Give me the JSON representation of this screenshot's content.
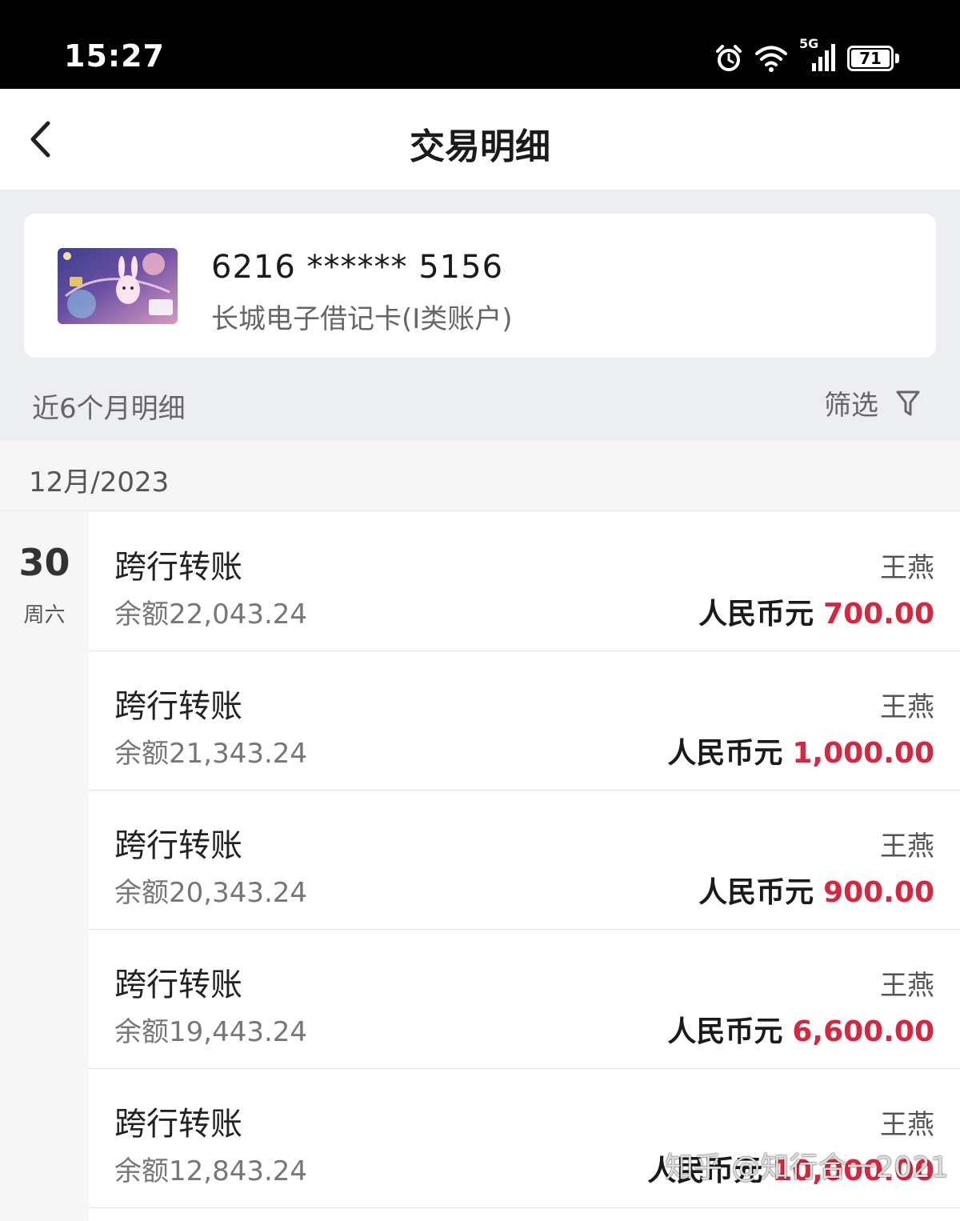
{
  "status_bar": {
    "time": "15:27",
    "network_type": "5G",
    "battery_level": "71",
    "icons": [
      "alarm-icon",
      "wifi-icon",
      "signal-icon",
      "battery-icon"
    ]
  },
  "header": {
    "title": "交易明细",
    "back_icon": "chevron-left-icon"
  },
  "account": {
    "card_number": "6216 ****** 5156",
    "card_type": "长城电子借记卡(I类账户)"
  },
  "filter_bar": {
    "period_label": "近6个月明细",
    "filter_label": "筛选",
    "filter_icon": "funnel-icon"
  },
  "month": {
    "label": "12月/2023"
  },
  "date_group": {
    "day": "30",
    "weekday": "周六"
  },
  "transactions": [
    {
      "type": "跨行转账",
      "balance": "余额22,043.24",
      "party": "王燕",
      "currency": "人民币元",
      "amount": "700.00"
    },
    {
      "type": "跨行转账",
      "balance": "余额21,343.24",
      "party": "王燕",
      "currency": "人民币元",
      "amount": "1,000.00"
    },
    {
      "type": "跨行转账",
      "balance": "余额20,343.24",
      "party": "王燕",
      "currency": "人民币元",
      "amount": "900.00"
    },
    {
      "type": "跨行转账",
      "balance": "余额19,443.24",
      "party": "王燕",
      "currency": "人民币元",
      "amount": "6,600.00"
    },
    {
      "type": "跨行转账",
      "balance": "余额12,843.24",
      "party": "王燕",
      "currency": "人民币元",
      "amount": "10,000.00"
    }
  ],
  "watermark": "知乎 @知行合一2021",
  "colors": {
    "amount_red": "#d8263e",
    "grey_background": "#eceef2",
    "status_bar": "#000000"
  }
}
